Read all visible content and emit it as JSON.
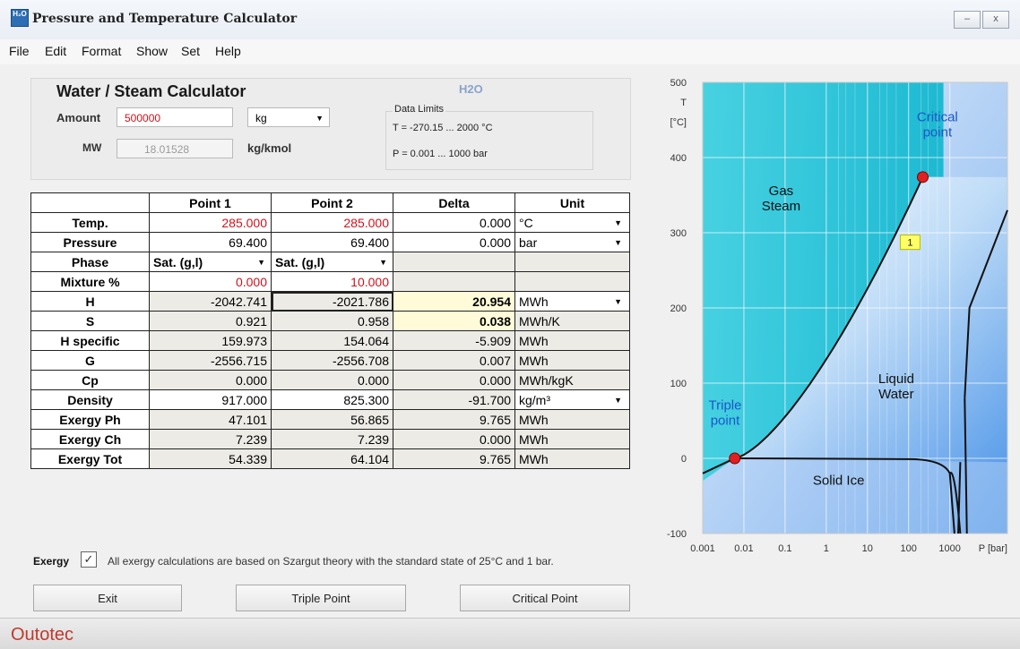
{
  "window": {
    "title": "Pressure and Temperature Calculator",
    "icon_text": "H₂O",
    "minimize": "–",
    "close": "x"
  },
  "menu": [
    "File",
    "Edit",
    "Format",
    "Show",
    "Set",
    "Help"
  ],
  "header": {
    "title": "Water / Steam Calculator",
    "substance": "H2O",
    "amount_label": "Amount",
    "amount_value": "500000",
    "amount_unit": "kg",
    "mw_label": "MW",
    "mw_value": "18.01528",
    "mw_unit": "kg/kmol",
    "limits_title": "Data Limits",
    "limits_t": "T = -270.15 ... 2000 °C",
    "limits_p": "P = 0.001 ... 1000 bar"
  },
  "table": {
    "columns": [
      "Point 1",
      "Point 2",
      "Delta",
      "Unit"
    ],
    "rows": {
      "temp": {
        "label": "Temp.",
        "p1": "285.000",
        "p2": "285.000",
        "delta": "0.000",
        "unit": "°C"
      },
      "pressure": {
        "label": "Pressure",
        "p1": "69.400",
        "p2": "69.400",
        "delta": "0.000",
        "unit": "bar"
      },
      "phase": {
        "label": "Phase",
        "p1": "Sat. (g,l)",
        "p2": "Sat. (g,l)"
      },
      "mixture": {
        "label": "Mixture %",
        "p1": "0.000",
        "p2": "10.000"
      },
      "h": {
        "label": "H",
        "p1": "-2042.741",
        "p2": "-2021.786",
        "delta": "20.954",
        "unit": "MWh"
      },
      "s": {
        "label": "S",
        "p1": "0.921",
        "p2": "0.958",
        "delta": "0.038",
        "unit": "MWh/K"
      },
      "hspec": {
        "label": "H specific",
        "p1": "159.973",
        "p2": "154.064",
        "delta": "-5.909",
        "unit": "MWh"
      },
      "g": {
        "label": "G",
        "p1": "-2556.715",
        "p2": "-2556.708",
        "delta": "0.007",
        "unit": "MWh"
      },
      "cp": {
        "label": "Cp",
        "p1": "0.000",
        "p2": "0.000",
        "delta": "0.000",
        "unit": "MWh/kgK"
      },
      "density": {
        "label": "Density",
        "p1": "917.000",
        "p2": "825.300",
        "delta": "-91.700",
        "unit": "kg/m³"
      },
      "exph": {
        "label": "Exergy Ph",
        "p1": "47.101",
        "p2": "56.865",
        "delta": "9.765",
        "unit": "MWh"
      },
      "exch": {
        "label": "Exergy Ch",
        "p1": "7.239",
        "p2": "7.239",
        "delta": "0.000",
        "unit": "MWh"
      },
      "extot": {
        "label": "Exergy Tot",
        "p1": "54.339",
        "p2": "64.104",
        "delta": "9.765",
        "unit": "MWh"
      }
    }
  },
  "exergy": {
    "label": "Exergy",
    "checked": "✓",
    "note": "All exergy calculations are based on Szargut theory with the standard state of 25°C and 1 bar."
  },
  "buttons": {
    "exit": "Exit",
    "triple": "Triple Point",
    "critical": "Critical Point"
  },
  "footer": {
    "brand": "Outotec"
  },
  "chart_data": {
    "type": "phase-diagram",
    "y_axis": {
      "label": "T",
      "unit": "[°C]",
      "ticks": [
        "500",
        "400",
        "300",
        "200",
        "100",
        "0",
        "-100"
      ],
      "range": [
        -100,
        500
      ]
    },
    "x_axis": {
      "label": "P [bar]",
      "ticks": [
        "0.001",
        "0.01",
        "0.1",
        "1",
        "10",
        "100",
        "1000"
      ],
      "scale": "log"
    },
    "regions": [
      "Gas Steam",
      "Liquid Water",
      "Solid Ice"
    ],
    "region_lines": {
      "gas": [
        "Gas",
        "Steam"
      ],
      "liquid": [
        "Liquid",
        "Water"
      ]
    },
    "triple_point": {
      "label_lines": [
        "Triple",
        "point"
      ],
      "P": 0.006,
      "T": 0.01
    },
    "critical_point": {
      "label_lines": [
        "Critical",
        "point"
      ],
      "P": 220.6,
      "T": 374
    },
    "marker": {
      "label": "1",
      "P": 69.4,
      "T": 285
    },
    "colors": {
      "gas": "#23c5d9",
      "liquid": "#7fb8f2",
      "line": "#111111",
      "point": "#e02020",
      "marker": "#ffff66"
    }
  }
}
